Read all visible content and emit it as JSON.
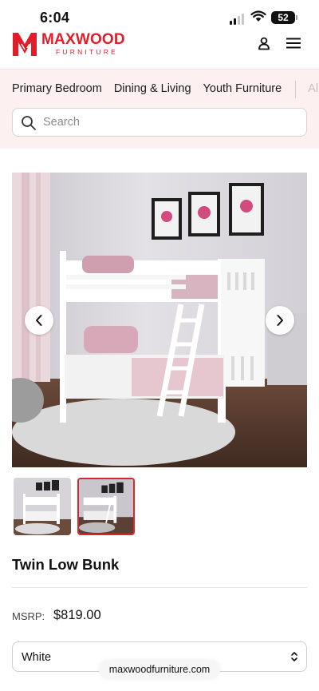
{
  "status_bar": {
    "time": "6:04",
    "battery": "52"
  },
  "brand": {
    "name": "MAXWOOD",
    "tagline": "FURNITURE",
    "accent_color": "#e11d2a"
  },
  "header": {
    "account_icon": "user-icon",
    "menu_icon": "hamburger-menu-icon"
  },
  "categories": [
    {
      "label": "Primary Bedroom"
    },
    {
      "label": "Dining & Living"
    },
    {
      "label": "Youth Furniture"
    },
    {
      "label": "Al"
    }
  ],
  "search": {
    "placeholder": "Search",
    "value": "",
    "icon": "search-icon"
  },
  "gallery": {
    "prev_icon": "chevron-left-icon",
    "next_icon": "chevron-right-icon",
    "thumbnail_count": 2,
    "selected_thumbnail": 2
  },
  "product": {
    "title": "Twin Low Bunk",
    "msrp_label": "MSRP:",
    "price": "$819.00",
    "color_selected": "White"
  },
  "browser": {
    "url": "maxwoodfurniture.com"
  }
}
